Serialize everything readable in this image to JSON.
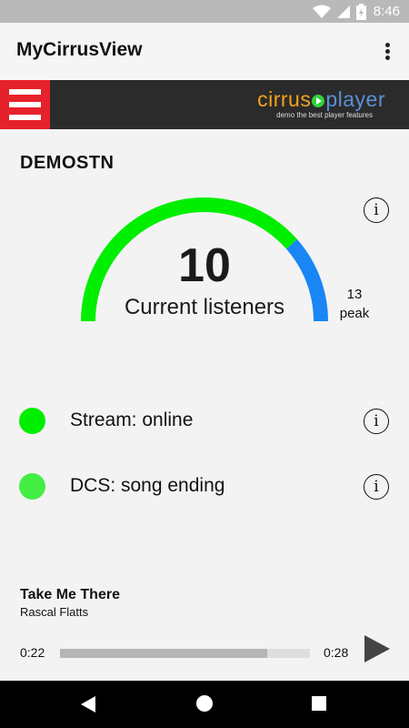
{
  "statusbar": {
    "time": "8:46",
    "icons": [
      "wifi-icon",
      "signal-icon",
      "battery-icon"
    ]
  },
  "appbar": {
    "title": "MyCirrusView",
    "menu_icon": "more-vert-icon"
  },
  "banner": {
    "menu_icon": "hamburger-menu-icon",
    "logo_text_part1": "cirrus",
    "logo_text_part2": "player",
    "tagline": "demo the best player features",
    "colors": {
      "menu_bg": "#e5222b",
      "bar_bg": "#2b2b2b"
    }
  },
  "station": {
    "name": "DEMOSTN"
  },
  "listeners": {
    "current": "10",
    "label": "Current listeners",
    "peak_value": "13",
    "peak_label": "peak",
    "gauge_fraction": 0.77,
    "colors": {
      "current": "#00ee00",
      "peak": "#1a85f5"
    }
  },
  "status": [
    {
      "label": "Stream: online",
      "color": "#00ee00"
    },
    {
      "label": "DCS: song ending",
      "color": "#44ee44"
    }
  ],
  "now_playing": {
    "title": "Take Me There",
    "artist": "Rascal Flatts",
    "elapsed": "0:22",
    "total": "0:28",
    "progress": 0.83
  },
  "info_icon_label": "i"
}
